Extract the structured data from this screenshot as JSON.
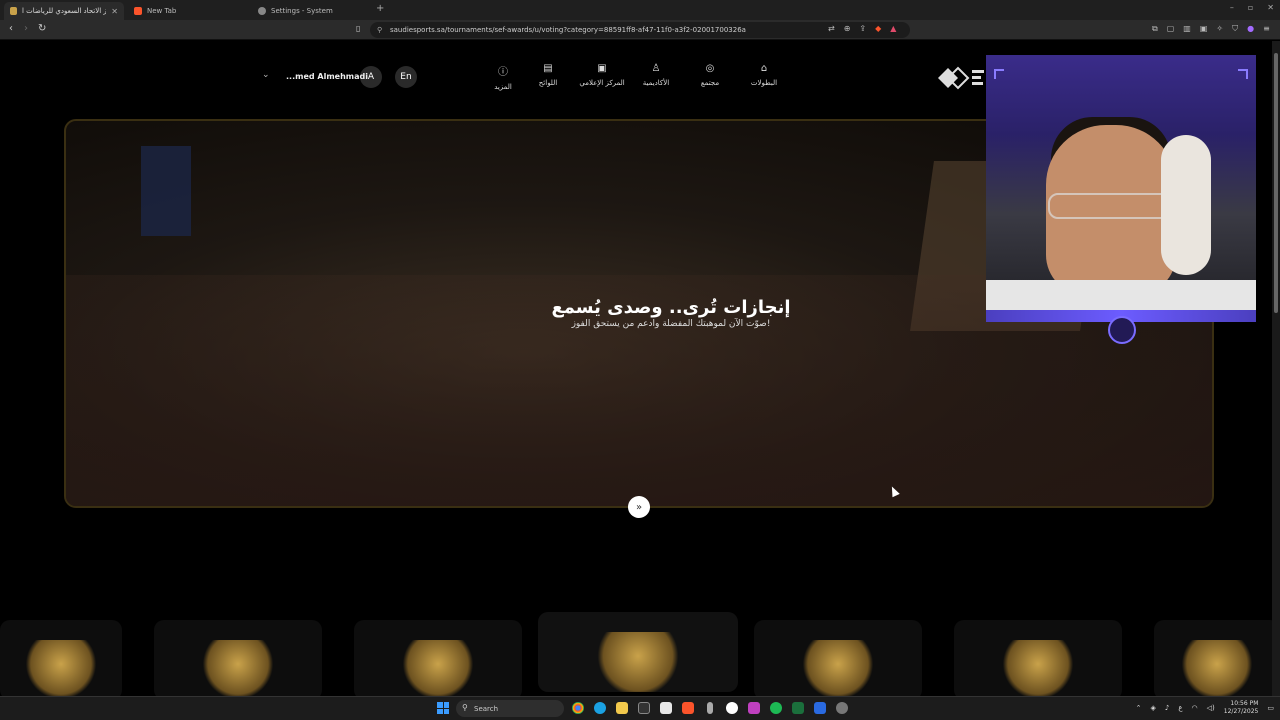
{
  "browser": {
    "tabs": [
      {
        "title": "جوائز الاتحاد السعودي للرياضات ا",
        "active": true,
        "color": "#c9a24a"
      },
      {
        "title": "New Tab",
        "active": false,
        "color": "#fb542b"
      },
      {
        "title": "Settings - System",
        "active": false,
        "color": "#888888"
      }
    ],
    "url": "saudiesports.sa/tournaments/sef-awards/u/voting?category=88591ff8-af47-11f0-a3f2-02001700326a"
  },
  "site": {
    "nav": [
      {
        "label": "البطولات",
        "icon": "trophy-icon"
      },
      {
        "label": "مجتمع",
        "icon": "community-icon"
      },
      {
        "label": "الأكاديمية",
        "icon": "academy-icon"
      },
      {
        "label": "المركز الإعلامي",
        "icon": "media-icon"
      },
      {
        "label": "اللوائح",
        "icon": "rules-icon"
      },
      {
        "label": "المزيد",
        "icon": "info-icon"
      }
    ],
    "lang_en": "En",
    "font_btn": "A",
    "username": "...med Almehmadi",
    "hero": {
      "title": "إنجازات تُرى.. وصدى يُسمع",
      "subtitle": "صوّت الآن لموهبتك المفضلة وادعم من يستحق الفوز!"
    },
    "accent": "#c9a24a"
  },
  "taskbar": {
    "search_label": "Search",
    "time": "10:56 PM",
    "date": "12/27/2025",
    "lang": "ع"
  }
}
